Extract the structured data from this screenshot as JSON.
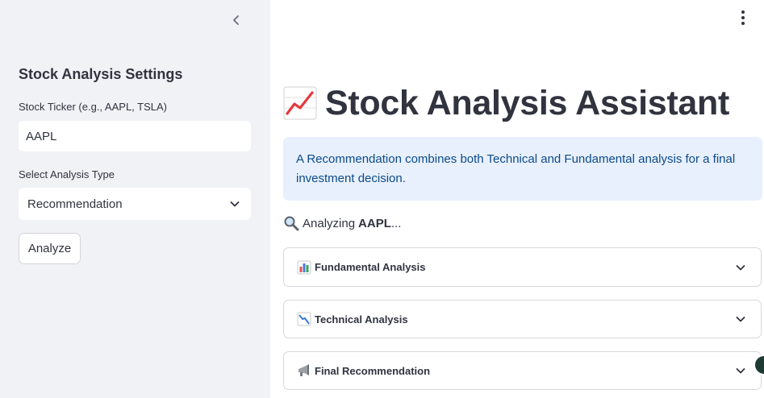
{
  "sidebar": {
    "title": "Stock Analysis Settings",
    "ticker_label": "Stock Ticker (e.g., AAPL, TSLA)",
    "ticker_value": "AAPL",
    "analysis_type_label": "Select Analysis Type",
    "analysis_type_value": "Recommendation",
    "analyze_button": "Analyze",
    "collapse_icon": "chevron-left-icon"
  },
  "main": {
    "title_icon": "chart-increasing-icon",
    "title": "Stock Analysis Assistant",
    "info_text": "A Recommendation combines both Technical and Fundamental analysis for a final investment decision.",
    "analyzing_prefix": "Analyzing",
    "analyzing_ticker": "AAPL",
    "analyzing_suffix": "...",
    "expanders": [
      {
        "icon": "bar-chart-icon",
        "label": "Fundamental Analysis"
      },
      {
        "icon": "chart-decreasing-icon",
        "label": "Technical Analysis"
      },
      {
        "icon": "megaphone-icon",
        "label": "Final Recommendation"
      }
    ]
  },
  "colors": {
    "sidebar_bg": "#f0f2f6",
    "info_bg": "#e8f0fd",
    "info_text": "#0b4a8a",
    "text": "#31333f"
  }
}
